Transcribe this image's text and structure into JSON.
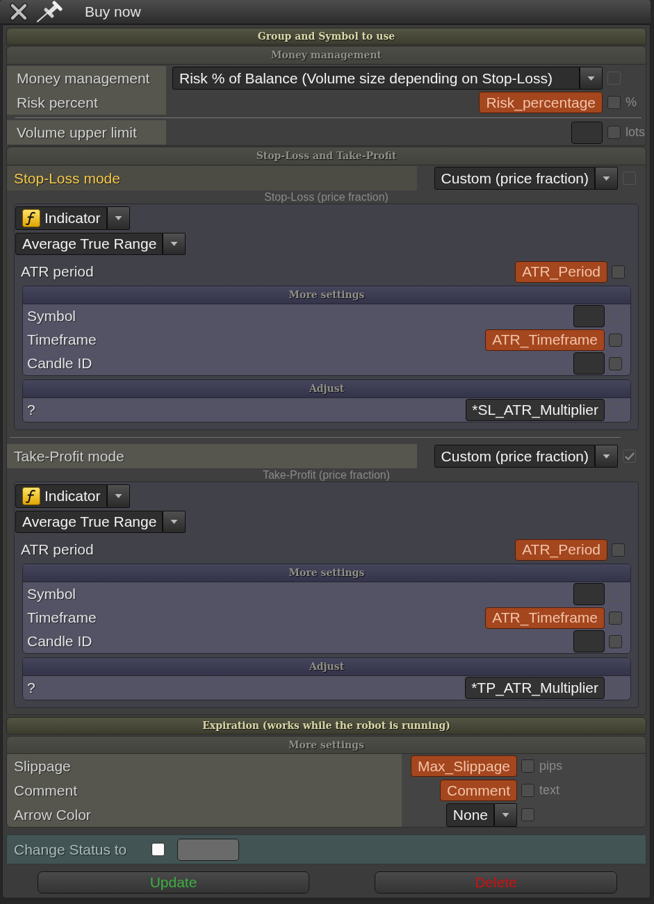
{
  "window": {
    "title": "Buy now"
  },
  "group_section": {
    "title": "Group and Symbol to use"
  },
  "money_management": {
    "title": "Money management",
    "groups": [
      [
        {
          "label": "Money management",
          "field": {
            "kind": "dropdown",
            "value": "Risk % of Balance (Volume size depending on Stop-Loss)"
          },
          "checkbox": {
            "checked": false,
            "disabled": true
          }
        },
        {
          "label": "Risk percent",
          "field": {
            "kind": "variable",
            "value": "Risk_percentage"
          },
          "checkbox": {
            "checked": false,
            "disabled": false
          },
          "unit": "%"
        }
      ],
      [
        {
          "label": "Volume upper limit",
          "field": {
            "kind": "input"
          },
          "checkbox": {
            "checked": false,
            "disabled": false
          },
          "unit": "lots"
        }
      ]
    ]
  },
  "stop_loss_take_profit": {
    "title": "Stop-Loss and Take-Profit",
    "modes": [
      {
        "label": "Stop-Loss mode",
        "highlighted": true,
        "field": {
          "kind": "dropdown",
          "value": "Custom (price fraction)"
        },
        "checkbox": {
          "checked": false,
          "disabled": true
        },
        "caption": "Stop-Loss (price fraction)",
        "source": {
          "kind": "dropdown",
          "value": "Indicator"
        },
        "indicator": {
          "kind": "dropdown",
          "value": "Average True Range"
        },
        "rows": [
          {
            "label": "ATR period",
            "field": {
              "kind": "variable",
              "value": "ATR_Period"
            },
            "checkbox": {
              "checked": false,
              "disabled": false
            }
          }
        ],
        "more_settings": {
          "title": "More settings",
          "rows": [
            {
              "label": "Symbol",
              "field": {
                "kind": "input"
              },
              "checkbox": {
                "checked": false,
                "disabled": true
              }
            },
            {
              "label": "Timeframe",
              "field": {
                "kind": "variable",
                "value": "ATR_Timeframe"
              },
              "checkbox": {
                "checked": false,
                "disabled": false
              }
            },
            {
              "label": "Candle ID",
              "field": {
                "kind": "input"
              },
              "checkbox": {
                "checked": false,
                "disabled": false
              }
            }
          ]
        },
        "adjust": {
          "title": "Adjust",
          "rows": [
            {
              "label": "?",
              "field": {
                "kind": "input",
                "value": "*SL_ATR_Multiplier"
              },
              "checkbox": {
                "checked": false,
                "disabled": true
              }
            }
          ]
        }
      },
      {
        "label": "Take-Profit mode",
        "highlighted": false,
        "field": {
          "kind": "dropdown",
          "value": "Custom (price fraction)"
        },
        "checkbox": {
          "checked": true,
          "disabled": true
        },
        "caption": "Take-Profit (price fraction)",
        "source": {
          "kind": "dropdown",
          "value": "Indicator"
        },
        "indicator": {
          "kind": "dropdown",
          "value": "Average True Range"
        },
        "rows": [
          {
            "label": "ATR period",
            "field": {
              "kind": "variable",
              "value": "ATR_Period"
            },
            "checkbox": {
              "checked": false,
              "disabled": false
            }
          }
        ],
        "more_settings": {
          "title": "More settings",
          "rows": [
            {
              "label": "Symbol",
              "field": {
                "kind": "input"
              },
              "checkbox": {
                "checked": false,
                "disabled": true
              }
            },
            {
              "label": "Timeframe",
              "field": {
                "kind": "variable",
                "value": "ATR_Timeframe"
              },
              "checkbox": {
                "checked": false,
                "disabled": false
              }
            },
            {
              "label": "Candle ID",
              "field": {
                "kind": "input"
              },
              "checkbox": {
                "checked": false,
                "disabled": false
              }
            }
          ]
        },
        "adjust": {
          "title": "Adjust",
          "rows": [
            {
              "label": "?",
              "field": {
                "kind": "input",
                "value": "*TP_ATR_Multiplier"
              },
              "checkbox": {
                "checked": false,
                "disabled": true
              }
            }
          ]
        }
      }
    ]
  },
  "expiration": {
    "title": "Expiration (works while the robot is running)"
  },
  "more_settings": {
    "title": "More settings",
    "rows": [
      {
        "label": "Slippage",
        "field": {
          "kind": "variable",
          "value": "Max_Slippage"
        },
        "checkbox": {
          "checked": false,
          "disabled": false
        },
        "unit": "pips"
      },
      {
        "label": "Comment",
        "field": {
          "kind": "variable",
          "value": "Comment"
        },
        "checkbox": {
          "checked": false,
          "disabled": false
        },
        "unit": "text"
      },
      {
        "label": "Arrow Color",
        "field": {
          "kind": "dropdown",
          "value": "None"
        },
        "checkbox": {
          "checked": false,
          "disabled": false
        }
      }
    ]
  },
  "status": {
    "label": "Change Status to",
    "checkbox": {
      "checked": false
    },
    "field": {
      "kind": "input"
    }
  },
  "buttons": [
    {
      "label": "Update",
      "color": "#3cb043"
    },
    {
      "label": "Delete",
      "color": "#cc1111"
    }
  ]
}
